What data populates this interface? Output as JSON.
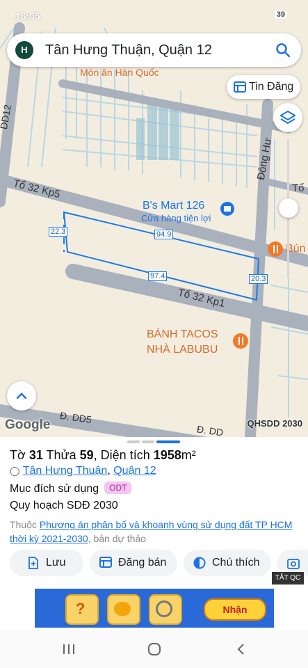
{
  "status_bar": {
    "time": "13:05",
    "battery": "39"
  },
  "search": {
    "avatar_letter": "H",
    "query": "Tân Hưng Thuận, Quận 12"
  },
  "map": {
    "btn_tin_dang": "Tin Đăng",
    "labels": {
      "mon_an": "Món ăn Hàn Quốc",
      "dd12": "DD12",
      "dong_hung": "Đông Hư",
      "to32_kp5": "Tổ 32 Kp5",
      "bs_mart": "B's Mart 126",
      "cua_hang": "Cửa hàng tiện lợi",
      "bun": "Bún",
      "to_right": "Tổ",
      "to32_kp1": "Tổ 32 Kp1",
      "banh_tacos_1": "BÁNH TACOS",
      "banh_tacos_2": "NHÀ LABUBU",
      "dd5": "Đ. DD5",
      "dd_right": "Đ. DD"
    },
    "dimensions": {
      "left": "22.3",
      "top": "94.9",
      "bottom": "97.4",
      "right": "20.3"
    },
    "google": "Google",
    "qhsdd": "QHSDD 2030"
  },
  "parcel": {
    "to_label": "Tờ",
    "to_value": "31",
    "thua_label": "Thửa",
    "thua_value": "59",
    "dt_label": ", Diện tích",
    "dt_value": "1958",
    "dt_unit": "m²",
    "ward": "Tân Hưng Thuận",
    "district": "Quận 12",
    "sep": ",",
    "purpose_label": "Mục đích sử dụng",
    "purpose_badge": "ODT",
    "plan_label": "Quy hoạch SDĐ 2030",
    "belongs_prefix": "Thuộc",
    "belongs_link": "Phương án phân bố và khoanh vùng sử dụng đất TP HCM thời kỳ 2021-2030",
    "belongs_suffix": ", bản dự thảo"
  },
  "actions": {
    "save": "Lưu",
    "post": "Đăng bán",
    "legend": "Chú thích"
  },
  "ad": {
    "tat_qc": "TẮT QC",
    "claim": "Nhận"
  },
  "colors": {
    "parcel_line": "#1a7be8",
    "accent": "#1a73e8",
    "badge_bg": "#f4c6f2",
    "avatar_bg": "#124a3c"
  }
}
